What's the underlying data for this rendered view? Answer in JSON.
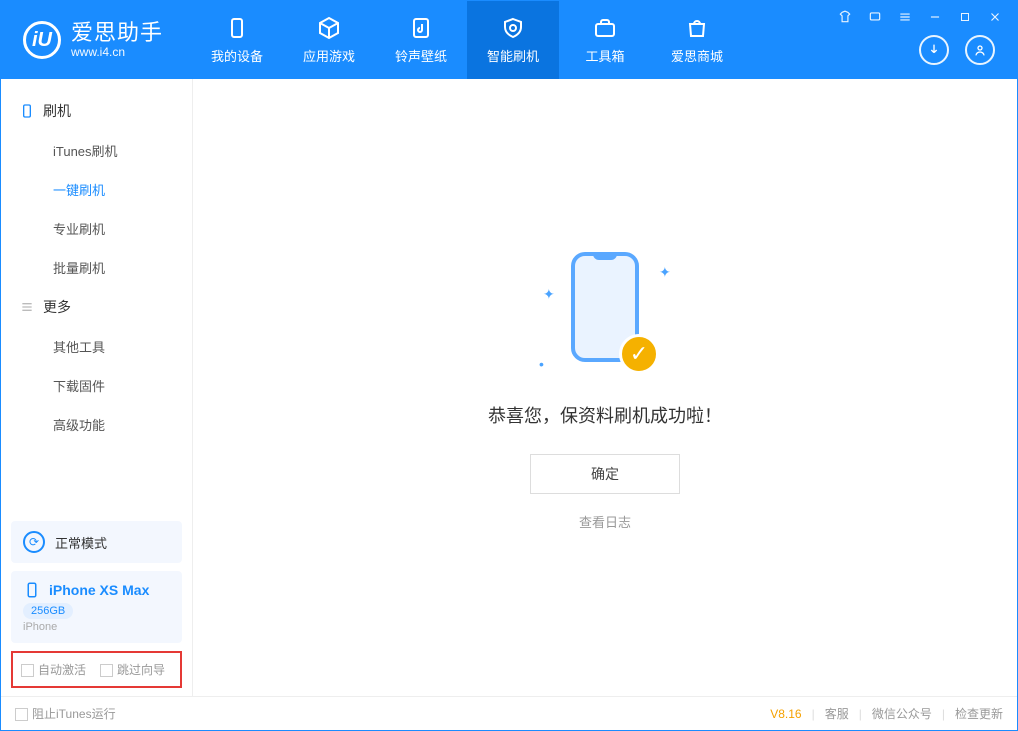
{
  "app": {
    "name": "爱思助手",
    "url": "www.i4.cn",
    "logo_letter": "iU"
  },
  "tabs": {
    "device": "我的设备",
    "apps": "应用游戏",
    "ringtone": "铃声壁纸",
    "flash": "智能刷机",
    "toolbox": "工具箱",
    "store": "爱思商城"
  },
  "sidebar": {
    "group_flash": "刷机",
    "items_flash": [
      "iTunes刷机",
      "一键刷机",
      "专业刷机",
      "批量刷机"
    ],
    "group_more": "更多",
    "items_more": [
      "其他工具",
      "下载固件",
      "高级功能"
    ]
  },
  "mode_panel": {
    "label": "正常模式"
  },
  "device": {
    "name": "iPhone XS Max",
    "storage": "256GB",
    "type": "iPhone"
  },
  "checks": {
    "auto_activate": "自动激活",
    "skip_guide": "跳过向导"
  },
  "main": {
    "success_msg": "恭喜您，保资料刷机成功啦！",
    "ok": "确定",
    "view_log": "查看日志"
  },
  "footer": {
    "block_itunes": "阻止iTunes运行",
    "version": "V8.16",
    "support": "客服",
    "wechat": "微信公众号",
    "check_update": "检查更新"
  }
}
